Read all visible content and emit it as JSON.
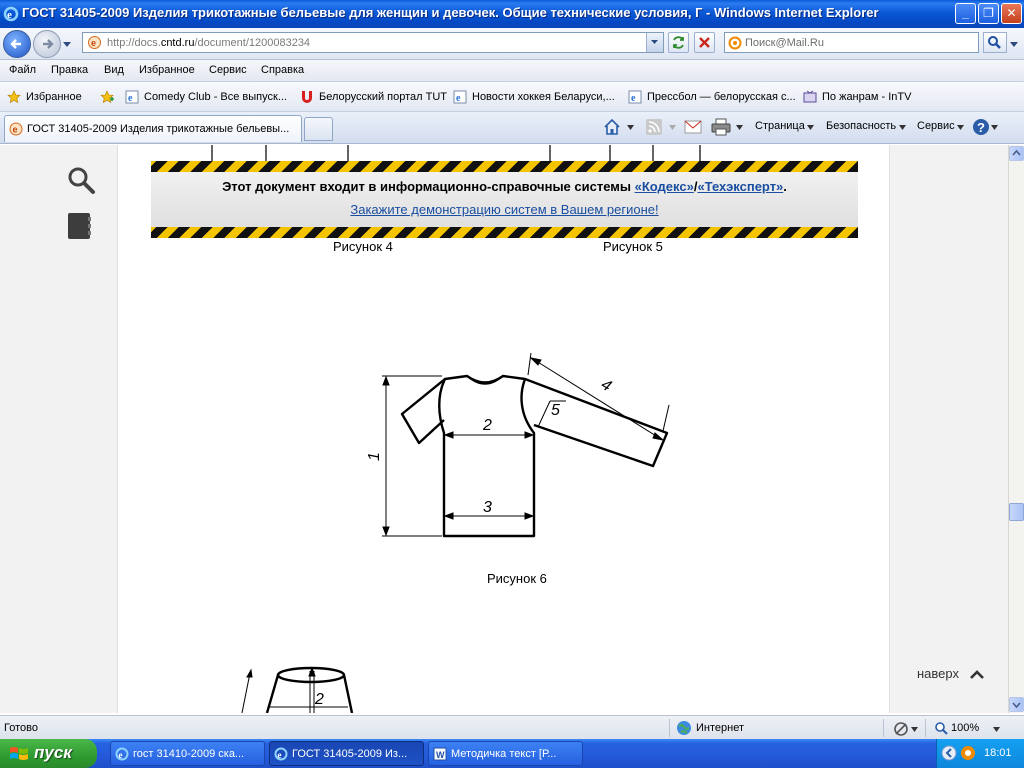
{
  "window": {
    "title": "ГОСТ 31405-2009 Изделия трикотажные бельевые для женщин и девочек. Общие технические условия, Г - Windows Internet Explorer"
  },
  "nav": {
    "url_prefix": "http://docs.",
    "url_domain": "cntd.ru",
    "url_path": "/document/1200083234",
    "search_placeholder": "Поиск@Mail.Ru"
  },
  "menu": [
    "Файл",
    "Правка",
    "Вид",
    "Избранное",
    "Сервис",
    "Справка"
  ],
  "favorites": {
    "label": "Избранное",
    "items": [
      "Comedy Club - Все выпуск...",
      "Белорусский портал TUT",
      "Новости хоккея Беларуси,...",
      "Прессбол — белорусская с...",
      "По жанрам - InTV"
    ]
  },
  "tabs": {
    "active": "ГОСТ 31405-2009 Изделия трикотажные бельевы...",
    "tools": [
      "Страница",
      "Безопасность",
      "Сервис"
    ]
  },
  "banner": {
    "text_before": "Этот документ входит в информационно-справочные системы ",
    "link1": "«Кодекс»",
    "slash": "/",
    "link2": "«Техэксперт»",
    "dot": ".",
    "line2": "Закажите демонстрацию систем в Вашем регионе!"
  },
  "figures": {
    "caption4": "Рисунок 4",
    "caption5": "Рисунок 5",
    "caption6": "Рисунок 6",
    "fig6_labels": [
      "1",
      "2",
      "3",
      "4",
      "5"
    ],
    "fig7_labels": [
      "2"
    ]
  },
  "page": {
    "to_top": "наверх"
  },
  "status": {
    "left": "Готово",
    "zone": "Интернет",
    "zoom": "100%"
  },
  "taskbar": {
    "start": "пуск",
    "tasks": [
      "гост 31410-2009 ска...",
      "ГОСТ 31405-2009 Из...",
      "Методичка текст [Р..."
    ],
    "clock": "18:01"
  }
}
